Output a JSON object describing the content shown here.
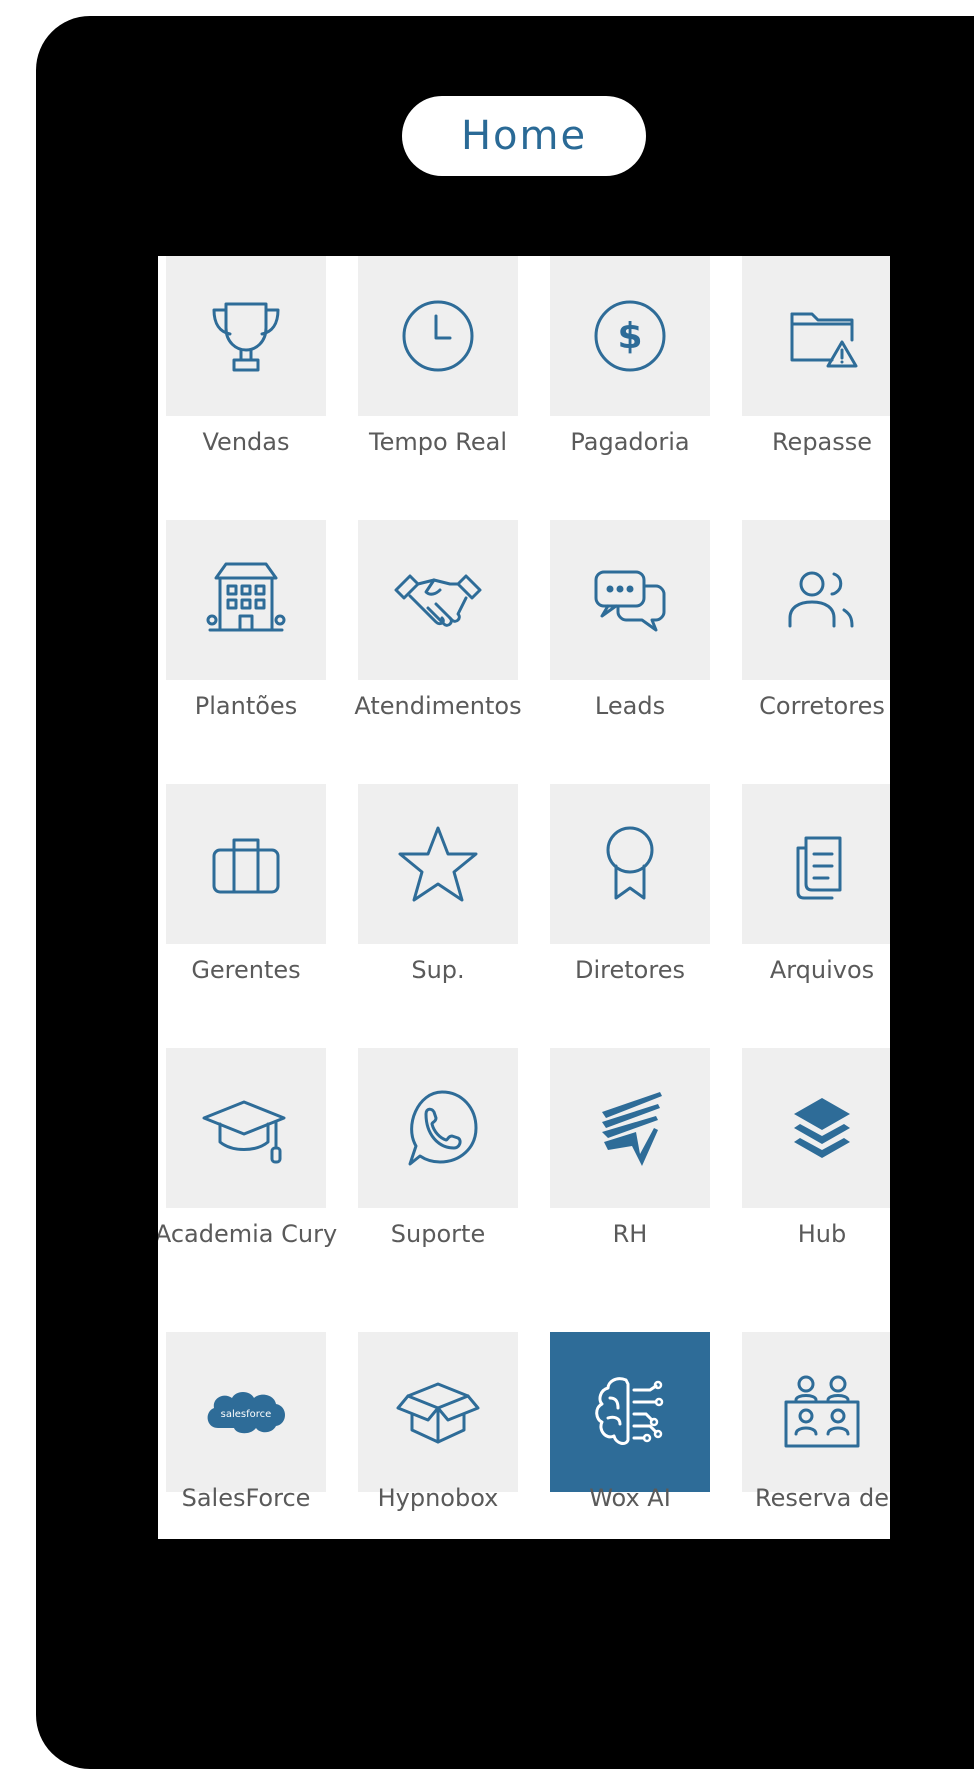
{
  "header": {
    "title": "Home"
  },
  "grid": {
    "items": [
      {
        "label": "Vendas",
        "icon": "trophy-icon"
      },
      {
        "label": "Tempo Real",
        "icon": "clock-icon"
      },
      {
        "label": "Pagadoria",
        "icon": "dollar-icon"
      },
      {
        "label": "Repasse",
        "icon": "folder-warning-icon"
      },
      {
        "label": "Plantões",
        "icon": "building-icon"
      },
      {
        "label": "Atendimentos",
        "icon": "handshake-icon"
      },
      {
        "label": "Leads",
        "icon": "chat-bubbles-icon"
      },
      {
        "label": "Corretores",
        "icon": "users-icon"
      },
      {
        "label": "Gerentes",
        "icon": "briefcase-icon"
      },
      {
        "label": "Sup.",
        "icon": "star-icon"
      },
      {
        "label": "Diretores",
        "icon": "award-ribbon-icon"
      },
      {
        "label": "Arquivos",
        "icon": "documents-icon"
      },
      {
        "label": "Academia Cury",
        "icon": "graduation-cap-icon"
      },
      {
        "label": "Suporte",
        "icon": "whatsapp-icon"
      },
      {
        "label": "RH",
        "icon": "rh-logo-icon"
      },
      {
        "label": "Hub",
        "icon": "layers-icon"
      },
      {
        "label": "SalesForce",
        "icon": "salesforce-logo-icon",
        "logo_text": "salesforce"
      },
      {
        "label": "Hypnobox",
        "icon": "open-box-icon"
      },
      {
        "label": "Wox AI",
        "icon": "ai-brain-icon",
        "active": true
      },
      {
        "label": "Reserva de",
        "icon": "meeting-room-icon"
      }
    ]
  },
  "colors": {
    "accent": "#2e6c98",
    "tile_bg": "#efefef",
    "label": "#5a5a5a",
    "frame": "#000000"
  }
}
